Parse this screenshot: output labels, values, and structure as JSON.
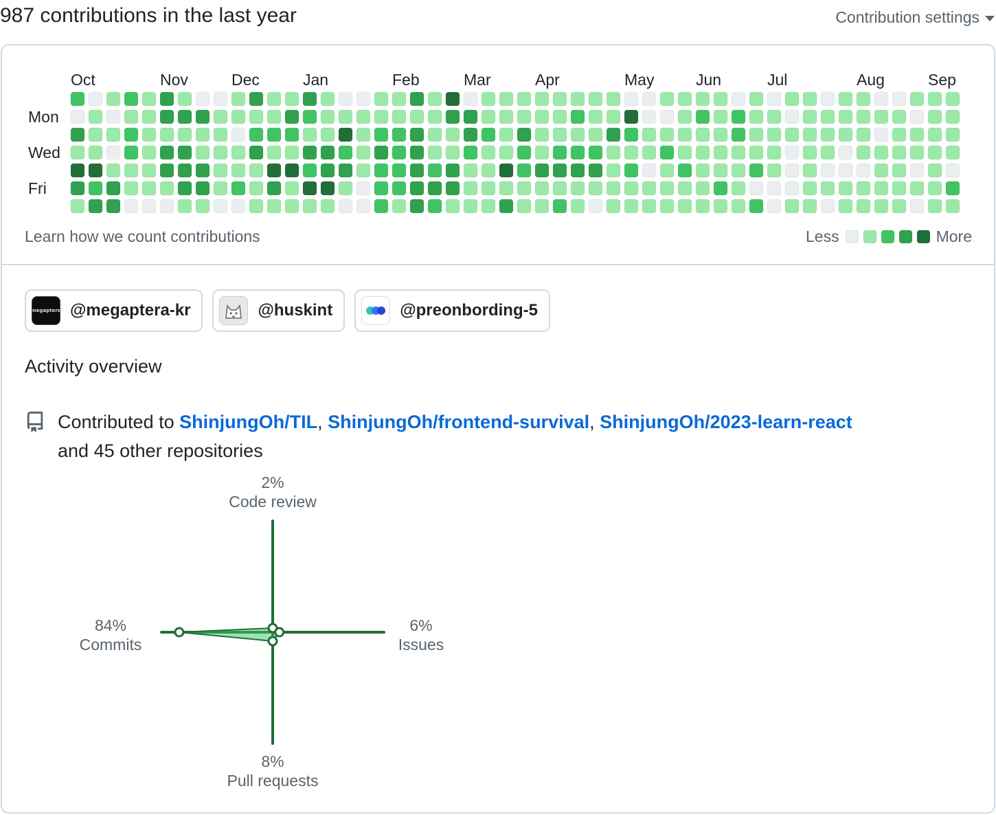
{
  "header": {
    "title": "987 contributions in the last year",
    "settings_label": "Contribution settings"
  },
  "calendar": {
    "months": [
      "Oct",
      "Nov",
      "Dec",
      "Jan",
      "Feb",
      "Mar",
      "Apr",
      "May",
      "Jun",
      "Jul",
      "Aug",
      "Sep"
    ],
    "day_labels": [
      "Mon",
      "Wed",
      "Fri"
    ],
    "level_colors": [
      "#ebeef1",
      "#9be9a8",
      "#40c463",
      "#30a14e",
      "#216e39"
    ],
    "weeks": [
      [
        2,
        0,
        3,
        1,
        4,
        3,
        1
      ],
      [
        0,
        1,
        1,
        1,
        4,
        2,
        3
      ],
      [
        1,
        0,
        1,
        0,
        1,
        3,
        3
      ],
      [
        2,
        1,
        2,
        2,
        1,
        1,
        0
      ],
      [
        1,
        1,
        1,
        1,
        1,
        1,
        0
      ],
      [
        3,
        3,
        1,
        3,
        3,
        1,
        0
      ],
      [
        1,
        3,
        1,
        3,
        3,
        3,
        1
      ],
      [
        0,
        3,
        1,
        1,
        3,
        3,
        1
      ],
      [
        0,
        1,
        1,
        1,
        1,
        1,
        0
      ],
      [
        1,
        1,
        0,
        1,
        1,
        2,
        0
      ],
      [
        3,
        1,
        2,
        3,
        1,
        1,
        1
      ],
      [
        1,
        1,
        2,
        1,
        4,
        3,
        1
      ],
      [
        1,
        3,
        2,
        1,
        4,
        1,
        1
      ],
      [
        3,
        2,
        1,
        3,
        2,
        4,
        1
      ],
      [
        1,
        1,
        1,
        3,
        3,
        4,
        1
      ],
      [
        0,
        1,
        4,
        2,
        3,
        1,
        0
      ],
      [
        0,
        1,
        1,
        1,
        1,
        0,
        0
      ],
      [
        1,
        1,
        2,
        3,
        2,
        2,
        2
      ],
      [
        1,
        1,
        2,
        2,
        2,
        2,
        1
      ],
      [
        3,
        1,
        3,
        3,
        3,
        3,
        3
      ],
      [
        1,
        1,
        1,
        1,
        2,
        3,
        2
      ],
      [
        4,
        3,
        1,
        1,
        3,
        3,
        1
      ],
      [
        0,
        3,
        3,
        2,
        1,
        1,
        1
      ],
      [
        1,
        1,
        2,
        1,
        1,
        1,
        1
      ],
      [
        1,
        1,
        1,
        1,
        4,
        1,
        3
      ],
      [
        1,
        1,
        3,
        2,
        2,
        1,
        1
      ],
      [
        1,
        1,
        1,
        1,
        3,
        1,
        1
      ],
      [
        1,
        1,
        1,
        2,
        3,
        1,
        2
      ],
      [
        1,
        2,
        1,
        2,
        3,
        1,
        1
      ],
      [
        1,
        1,
        1,
        2,
        3,
        1,
        0
      ],
      [
        1,
        1,
        3,
        1,
        1,
        1,
        1
      ],
      [
        0,
        4,
        2,
        1,
        2,
        1,
        1
      ],
      [
        0,
        0,
        1,
        1,
        0,
        1,
        1
      ],
      [
        1,
        0,
        1,
        2,
        1,
        1,
        1
      ],
      [
        1,
        1,
        1,
        1,
        2,
        1,
        1
      ],
      [
        1,
        2,
        1,
        1,
        1,
        1,
        1
      ],
      [
        1,
        1,
        1,
        1,
        1,
        2,
        1
      ],
      [
        0,
        2,
        2,
        1,
        1,
        1,
        1
      ],
      [
        1,
        1,
        1,
        1,
        2,
        0,
        2
      ],
      [
        0,
        1,
        1,
        1,
        1,
        0,
        0
      ],
      [
        1,
        0,
        1,
        0,
        0,
        0,
        1
      ],
      [
        1,
        1,
        1,
        1,
        1,
        1,
        1
      ],
      [
        0,
        1,
        1,
        1,
        0,
        1,
        0
      ],
      [
        1,
        1,
        1,
        0,
        0,
        1,
        1
      ],
      [
        1,
        1,
        1,
        1,
        0,
        1,
        1
      ],
      [
        0,
        1,
        0,
        1,
        1,
        1,
        1
      ],
      [
        0,
        1,
        1,
        1,
        1,
        1,
        1
      ],
      [
        1,
        0,
        1,
        1,
        0,
        1,
        0
      ],
      [
        1,
        1,
        1,
        1,
        1,
        1,
        1
      ],
      [
        1,
        1,
        1,
        1,
        0,
        2,
        1
      ]
    ],
    "learn_link": "Learn how we count contributions",
    "legend_less": "Less",
    "legend_more": "More"
  },
  "organizations": [
    {
      "handle": "@megaptera-kr",
      "avatar_icon": "megaptera-logo-icon",
      "avatar_text": "megaptera"
    },
    {
      "handle": "@huskint",
      "avatar_icon": "husky-logo-icon"
    },
    {
      "handle": "@preonbording-5",
      "avatar_icon": "dots-logo-icon"
    }
  ],
  "activity": {
    "title": "Activity overview",
    "contributed_prefix": "Contributed to",
    "repos": [
      "ShinjungOh/TIL",
      "ShinjungOh/frontend-survival",
      "ShinjungOh/2023-learn-react"
    ],
    "suffix": "and 45 other repositories",
    "repo_icon": "repo-icon"
  },
  "chart_data": {
    "type": "radar",
    "axes": [
      {
        "label": "Code review",
        "percent": "2%",
        "value": 2
      },
      {
        "label": "Issues",
        "percent": "6%",
        "value": 6
      },
      {
        "label": "Pull requests",
        "percent": "8%",
        "value": 8
      },
      {
        "label": "Commits",
        "percent": "84%",
        "value": 84
      }
    ],
    "line_color": "#216e39",
    "fill_color": "#40c463"
  }
}
